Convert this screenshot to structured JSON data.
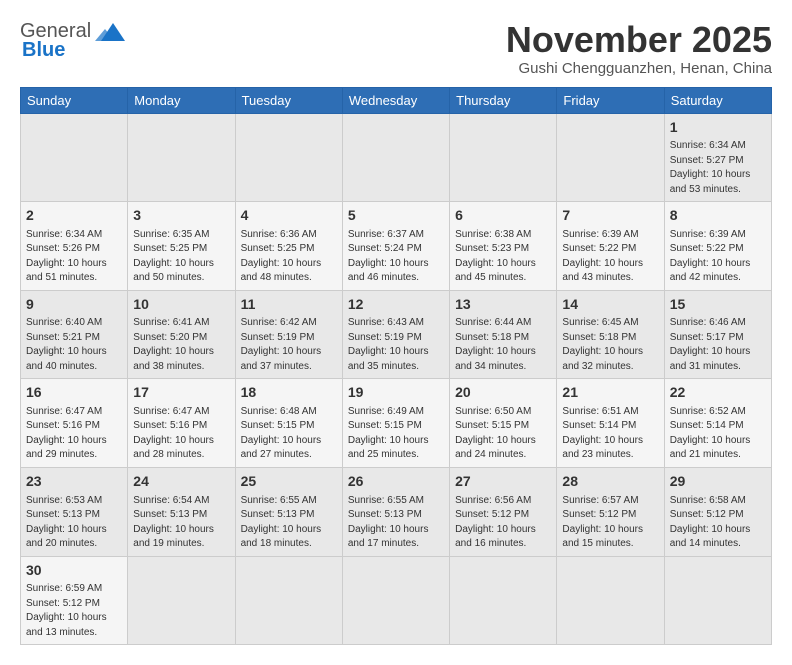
{
  "header": {
    "logo_line1": "General",
    "logo_line2": "Blue",
    "month_title": "November 2025",
    "location": "Gushi Chengguanzhen, Henan, China"
  },
  "days_of_week": [
    "Sunday",
    "Monday",
    "Tuesday",
    "Wednesday",
    "Thursday",
    "Friday",
    "Saturday"
  ],
  "weeks": [
    [
      {
        "day": "",
        "info": ""
      },
      {
        "day": "",
        "info": ""
      },
      {
        "day": "",
        "info": ""
      },
      {
        "day": "",
        "info": ""
      },
      {
        "day": "",
        "info": ""
      },
      {
        "day": "",
        "info": ""
      },
      {
        "day": "1",
        "info": "Sunrise: 6:34 AM\nSunset: 5:27 PM\nDaylight: 10 hours\nand 53 minutes."
      }
    ],
    [
      {
        "day": "2",
        "info": "Sunrise: 6:34 AM\nSunset: 5:26 PM\nDaylight: 10 hours\nand 51 minutes."
      },
      {
        "day": "3",
        "info": "Sunrise: 6:35 AM\nSunset: 5:25 PM\nDaylight: 10 hours\nand 50 minutes."
      },
      {
        "day": "4",
        "info": "Sunrise: 6:36 AM\nSunset: 5:25 PM\nDaylight: 10 hours\nand 48 minutes."
      },
      {
        "day": "5",
        "info": "Sunrise: 6:37 AM\nSunset: 5:24 PM\nDaylight: 10 hours\nand 46 minutes."
      },
      {
        "day": "6",
        "info": "Sunrise: 6:38 AM\nSunset: 5:23 PM\nDaylight: 10 hours\nand 45 minutes."
      },
      {
        "day": "7",
        "info": "Sunrise: 6:39 AM\nSunset: 5:22 PM\nDaylight: 10 hours\nand 43 minutes."
      },
      {
        "day": "8",
        "info": "Sunrise: 6:39 AM\nSunset: 5:22 PM\nDaylight: 10 hours\nand 42 minutes."
      }
    ],
    [
      {
        "day": "9",
        "info": "Sunrise: 6:40 AM\nSunset: 5:21 PM\nDaylight: 10 hours\nand 40 minutes."
      },
      {
        "day": "10",
        "info": "Sunrise: 6:41 AM\nSunset: 5:20 PM\nDaylight: 10 hours\nand 38 minutes."
      },
      {
        "day": "11",
        "info": "Sunrise: 6:42 AM\nSunset: 5:19 PM\nDaylight: 10 hours\nand 37 minutes."
      },
      {
        "day": "12",
        "info": "Sunrise: 6:43 AM\nSunset: 5:19 PM\nDaylight: 10 hours\nand 35 minutes."
      },
      {
        "day": "13",
        "info": "Sunrise: 6:44 AM\nSunset: 5:18 PM\nDaylight: 10 hours\nand 34 minutes."
      },
      {
        "day": "14",
        "info": "Sunrise: 6:45 AM\nSunset: 5:18 PM\nDaylight: 10 hours\nand 32 minutes."
      },
      {
        "day": "15",
        "info": "Sunrise: 6:46 AM\nSunset: 5:17 PM\nDaylight: 10 hours\nand 31 minutes."
      }
    ],
    [
      {
        "day": "16",
        "info": "Sunrise: 6:47 AM\nSunset: 5:16 PM\nDaylight: 10 hours\nand 29 minutes."
      },
      {
        "day": "17",
        "info": "Sunrise: 6:47 AM\nSunset: 5:16 PM\nDaylight: 10 hours\nand 28 minutes."
      },
      {
        "day": "18",
        "info": "Sunrise: 6:48 AM\nSunset: 5:15 PM\nDaylight: 10 hours\nand 27 minutes."
      },
      {
        "day": "19",
        "info": "Sunrise: 6:49 AM\nSunset: 5:15 PM\nDaylight: 10 hours\nand 25 minutes."
      },
      {
        "day": "20",
        "info": "Sunrise: 6:50 AM\nSunset: 5:15 PM\nDaylight: 10 hours\nand 24 minutes."
      },
      {
        "day": "21",
        "info": "Sunrise: 6:51 AM\nSunset: 5:14 PM\nDaylight: 10 hours\nand 23 minutes."
      },
      {
        "day": "22",
        "info": "Sunrise: 6:52 AM\nSunset: 5:14 PM\nDaylight: 10 hours\nand 21 minutes."
      }
    ],
    [
      {
        "day": "23",
        "info": "Sunrise: 6:53 AM\nSunset: 5:13 PM\nDaylight: 10 hours\nand 20 minutes."
      },
      {
        "day": "24",
        "info": "Sunrise: 6:54 AM\nSunset: 5:13 PM\nDaylight: 10 hours\nand 19 minutes."
      },
      {
        "day": "25",
        "info": "Sunrise: 6:55 AM\nSunset: 5:13 PM\nDaylight: 10 hours\nand 18 minutes."
      },
      {
        "day": "26",
        "info": "Sunrise: 6:55 AM\nSunset: 5:13 PM\nDaylight: 10 hours\nand 17 minutes."
      },
      {
        "day": "27",
        "info": "Sunrise: 6:56 AM\nSunset: 5:12 PM\nDaylight: 10 hours\nand 16 minutes."
      },
      {
        "day": "28",
        "info": "Sunrise: 6:57 AM\nSunset: 5:12 PM\nDaylight: 10 hours\nand 15 minutes."
      },
      {
        "day": "29",
        "info": "Sunrise: 6:58 AM\nSunset: 5:12 PM\nDaylight: 10 hours\nand 14 minutes."
      }
    ],
    [
      {
        "day": "30",
        "info": "Sunrise: 6:59 AM\nSunset: 5:12 PM\nDaylight: 10 hours\nand 13 minutes."
      },
      {
        "day": "",
        "info": ""
      },
      {
        "day": "",
        "info": ""
      },
      {
        "day": "",
        "info": ""
      },
      {
        "day": "",
        "info": ""
      },
      {
        "day": "",
        "info": ""
      },
      {
        "day": "",
        "info": ""
      }
    ]
  ]
}
